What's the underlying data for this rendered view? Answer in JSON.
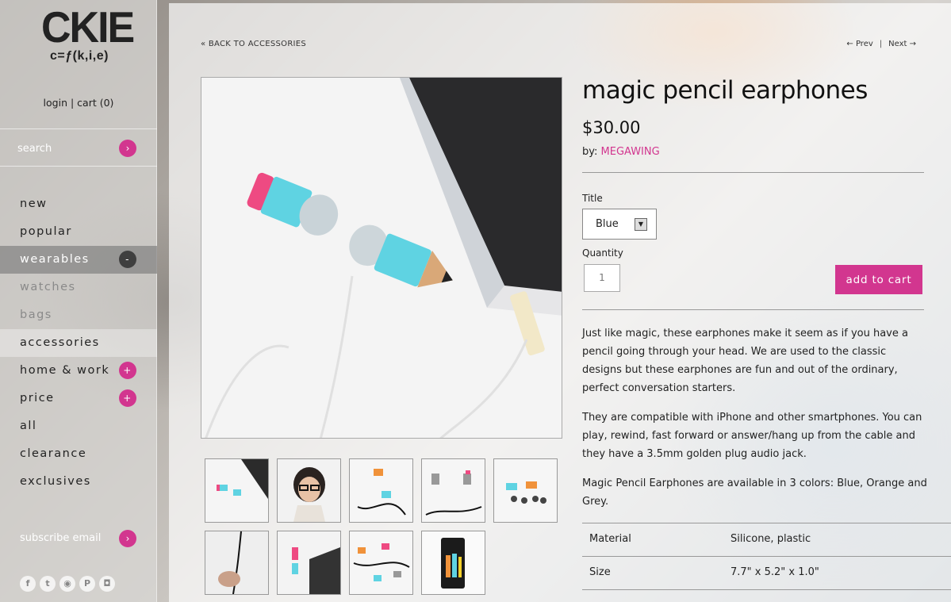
{
  "logo": {
    "line1": "CKIE",
    "line2": "c=ƒ(k,i,e)"
  },
  "user": {
    "login": "login",
    "separator": " | ",
    "cart": "cart (0)"
  },
  "search": {
    "placeholder": "search",
    "button": "›"
  },
  "nav": [
    {
      "label": "new",
      "state": "normal"
    },
    {
      "label": "popular",
      "state": "normal"
    },
    {
      "label": "wearables",
      "state": "active",
      "toggle": "-"
    },
    {
      "label": "watches",
      "state": "sub"
    },
    {
      "label": "bags",
      "state": "sub"
    },
    {
      "label": "accessories",
      "state": "subselected"
    },
    {
      "label": "home & work",
      "state": "normal",
      "toggle": "+"
    },
    {
      "label": "price",
      "state": "normal",
      "toggle": "+"
    },
    {
      "label": "all",
      "state": "normal"
    },
    {
      "label": "clearance",
      "state": "normal"
    },
    {
      "label": "exclusives",
      "state": "normal"
    }
  ],
  "subscribe": {
    "label": "subscribe email",
    "button": "›"
  },
  "social": [
    {
      "icon": "facebook-icon",
      "glyph": "f"
    },
    {
      "icon": "twitter-icon",
      "glyph": "t"
    },
    {
      "icon": "rss-icon",
      "glyph": "◉"
    },
    {
      "icon": "pinterest-icon",
      "glyph": "P"
    },
    {
      "icon": "instagram-icon",
      "glyph": "◘"
    }
  ],
  "breadcrumb": "« BACK TO ACCESSORIES",
  "pager": {
    "prev": "← Prev",
    "sep": "|",
    "next": "Next →"
  },
  "product": {
    "title": "magic pencil earphones",
    "price": "$30.00",
    "by_label": "by: ",
    "vendor": "MEGAWING",
    "option_label": "Title",
    "option_value": "Blue",
    "quantity_label": "Quantity",
    "quantity": "1",
    "add_to_cart": "add to cart",
    "description": [
      "Just like magic, these earphones make it seem as if you have a pencil going through your head. We are used to the classic designs but these earphones are fun and out of the ordinary, perfect conversation starters.",
      "They are compatible with iPhone and other smartphones. You can play, rewind, fast forward or answer/hang up from the cable and they have a 3.5mm golden plug audio jack.",
      "Magic Pencil Earphones are available in 3 colors: Blue, Orange and Grey."
    ],
    "specs": [
      {
        "key": "Material",
        "value": "Silicone, plastic"
      },
      {
        "key": "Size",
        "value": "7.7\" x 5.2\" x 1.0\""
      }
    ]
  },
  "colors": {
    "accent": "#d2368f"
  }
}
